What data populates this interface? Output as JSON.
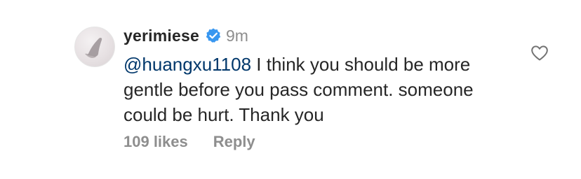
{
  "comment": {
    "username": "yerimiese",
    "verified_icon": "verified-badge-icon",
    "timestamp": "9m",
    "mention": "@huangxu1108",
    "text": " I think you should be more gentle before you pass comment. someone could be hurt. Thank you",
    "likes": "109 likes",
    "reply_label": "Reply",
    "like_icon": "heart-outline-icon"
  },
  "colors": {
    "username": "#262626",
    "secondary": "#8e8e8e",
    "mention": "#00376b",
    "verified": "#3897f0"
  }
}
